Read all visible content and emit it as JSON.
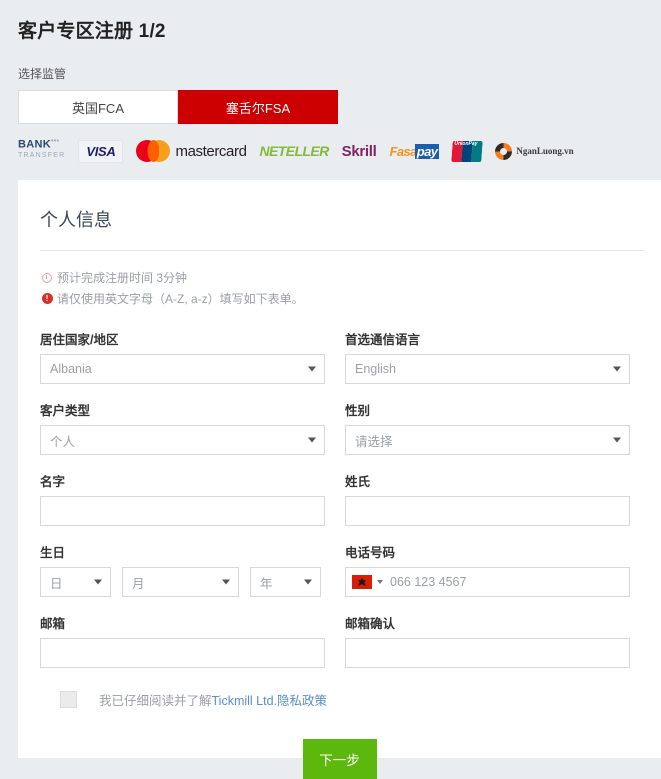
{
  "header": {
    "title": "客户专区注册 1/2",
    "regulator_label": "选择监管",
    "tabs": [
      {
        "label": "英国FCA",
        "active": false
      },
      {
        "label": "塞舌尔FSA",
        "active": true
      }
    ],
    "active_color": "#cc0000"
  },
  "payments": [
    {
      "name": "bank-transfer",
      "line1": "BANK",
      "sup": "•••",
      "line2": "TRANSFER"
    },
    {
      "name": "visa",
      "label": "VISA"
    },
    {
      "name": "mastercard",
      "label": "mastercard"
    },
    {
      "name": "neteller",
      "label": "NETELLER"
    },
    {
      "name": "skrill",
      "label": "Skrill"
    },
    {
      "name": "fasapay",
      "part1": "Fasa",
      "part2": "pay"
    },
    {
      "name": "unionpay",
      "label": "UnionPay",
      "sub": "银联"
    },
    {
      "name": "nganluong",
      "label": "NganLuong.vn"
    }
  ],
  "form": {
    "section_title": "个人信息",
    "notes": [
      {
        "icon": "clock-icon",
        "text": "预计完成注册时间 3分钟"
      },
      {
        "icon": "exclamation-icon",
        "text": "请仅使用英文字母（A-Z, a-z）填写如下表单。"
      }
    ],
    "fields": {
      "country": {
        "label": "居住国家/地区",
        "value": "Albania"
      },
      "language": {
        "label": "首选通信语言",
        "value": "English"
      },
      "client_type": {
        "label": "客户类型",
        "value": "个人"
      },
      "gender": {
        "label": "性别",
        "value": "请选择"
      },
      "first_name": {
        "label": "名字",
        "value": ""
      },
      "last_name": {
        "label": "姓氏",
        "value": ""
      },
      "birthday": {
        "label": "生日",
        "day": "日",
        "month": "月",
        "year": "年"
      },
      "phone": {
        "label": "电话号码",
        "placeholder": "066 123 4567",
        "flag": "albania-flag"
      },
      "email": {
        "label": "邮箱",
        "value": ""
      },
      "email_confirm": {
        "label": "邮箱确认",
        "value": ""
      }
    },
    "consent": {
      "text": "我已仔细阅读并了解",
      "link": "Tickmill Ltd.隐私政策",
      "checked": false
    },
    "submit": {
      "label": "下一步",
      "color": "#5cb80c"
    }
  }
}
